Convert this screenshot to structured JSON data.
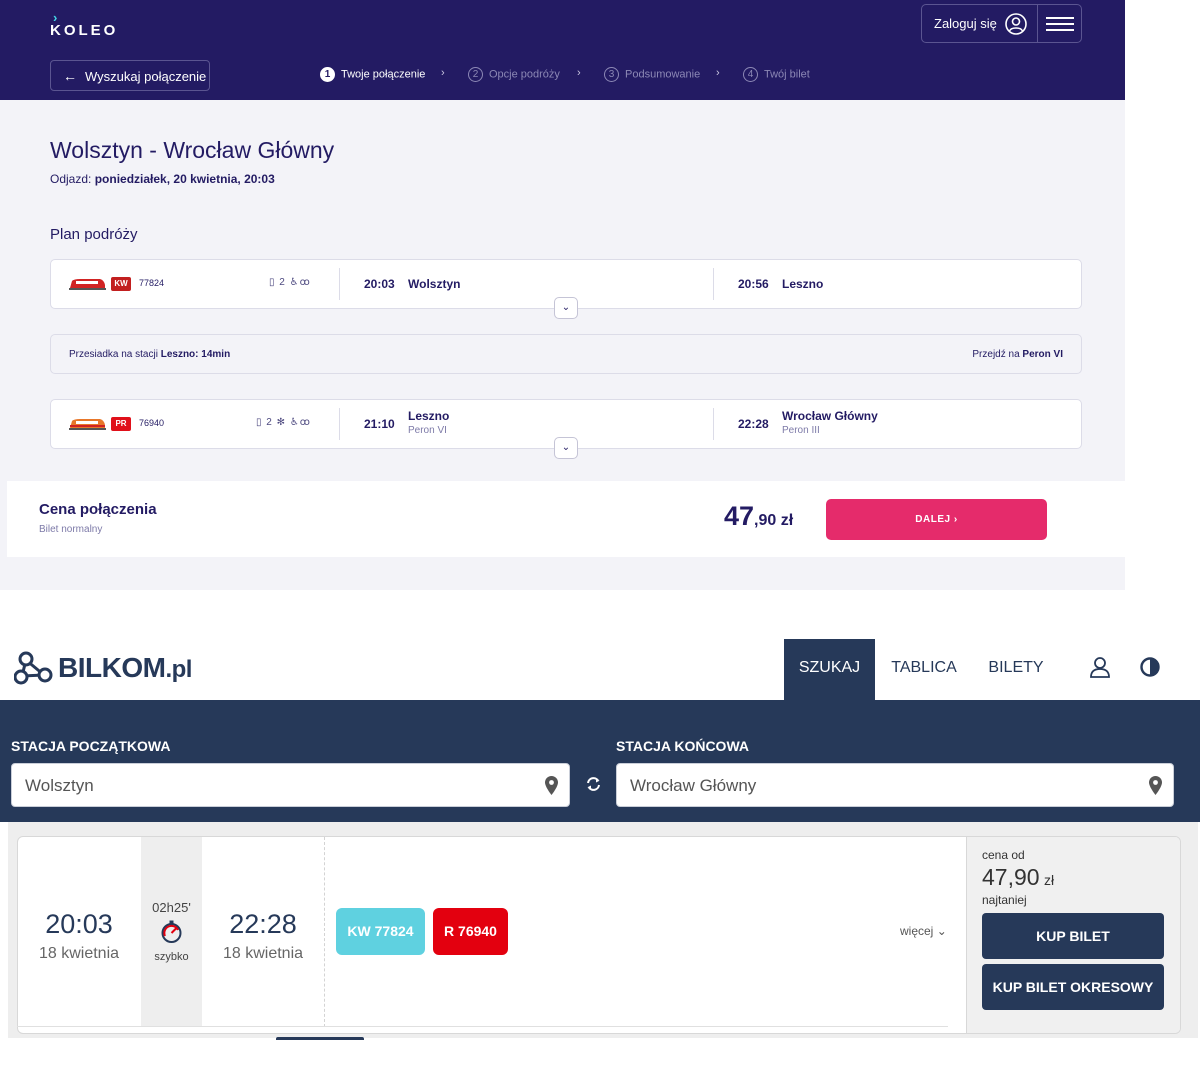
{
  "koleo": {
    "logo": "KOLEO",
    "login_label": "Zaloguj się",
    "back_label": "Wyszukaj połączenie",
    "steps": [
      {
        "num": "1",
        "label": "Twoje połączenie"
      },
      {
        "num": "2",
        "label": "Opcje podróży"
      },
      {
        "num": "3",
        "label": "Podsumowanie"
      },
      {
        "num": "4",
        "label": "Twój bilet"
      }
    ],
    "title": "Wolsztyn - Wrocław Główny",
    "departure_label": "Odjazd:",
    "departure_value": "poniedziałek, 20 kwietnia, 20:03",
    "plan_title": "Plan podróży",
    "legs": [
      {
        "carrier": "KW",
        "train_no": "77824",
        "amenities": "2",
        "dep_time": "20:03",
        "dep_station": "Wolsztyn",
        "dep_platform": "",
        "arr_time": "20:56",
        "arr_station": "Leszno",
        "arr_platform": ""
      },
      {
        "carrier": "PR",
        "train_no": "76940",
        "amenities": "2",
        "dep_time": "21:10",
        "dep_station": "Leszno",
        "dep_platform": "Peron VI",
        "arr_time": "22:28",
        "arr_station": "Wrocław Główny",
        "arr_platform": "Peron III"
      }
    ],
    "transfer": {
      "prefix": "Przesiadka na stacji",
      "station_time": "Leszno: 14min",
      "go_prefix": "Przejdź na",
      "platform": "Peron VI"
    },
    "price": {
      "title": "Cena połączenia",
      "subtitle": "Bilet normalny",
      "amount_main": "47",
      "amount_rest": ",90 zł",
      "button": "DALEJ"
    },
    "colors": {
      "header": "#231b63",
      "accent": "#e52b6b",
      "kw_badge": "#c21f1f",
      "pr_badge": "#e0101a"
    }
  },
  "bilkom": {
    "logo_main": "BILKOM",
    "logo_suffix": ".pl",
    "nav": [
      "SZUKAJ",
      "TABLICA",
      "BILETY"
    ],
    "from_label": "STACJA POCZĄTKOWA",
    "from_value": "Wolsztyn",
    "to_label": "STACJA KOŃCOWA",
    "to_value": "Wrocław Główny",
    "result": {
      "dep_time": "20:03",
      "dep_date": "18 kwietnia",
      "duration": "02h25'",
      "speed_label": "szybko",
      "arr_time": "22:28",
      "arr_date": "18 kwietnia",
      "trains": [
        "KW 77824",
        "R 76940"
      ],
      "more": "więcej",
      "price_from": "cena od",
      "price_value": "47,90",
      "price_currency": "zł",
      "cheapest": "najtaniej",
      "buy": "KUP BILET",
      "buy_period": "KUP BILET OKRESOWY"
    },
    "colors": {
      "primary": "#263959",
      "kw": "#5fd1e0",
      "r": "#e3000f"
    }
  }
}
